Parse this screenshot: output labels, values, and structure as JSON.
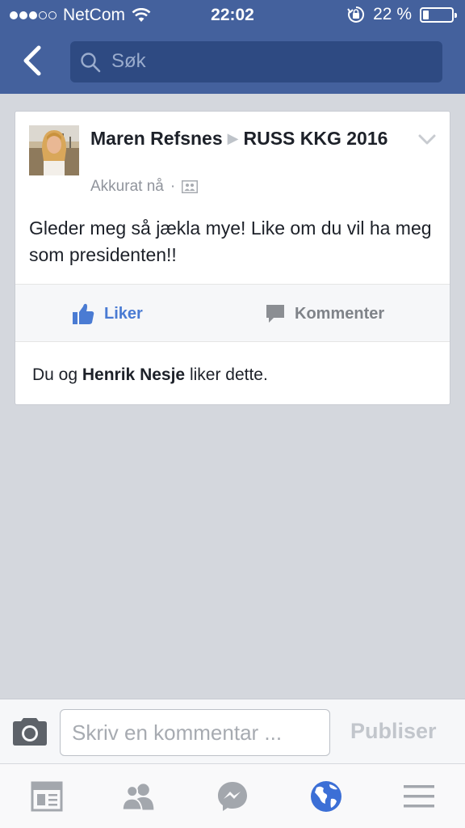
{
  "status_bar": {
    "carrier": "NetCom",
    "time": "22:02",
    "battery": "22 %",
    "battery_level": 0.22
  },
  "header": {
    "search_placeholder": "Søk"
  },
  "post": {
    "author": "Maren Refsnes",
    "group": "RUSS KKG 2016",
    "timestamp": "Akkurat nå",
    "meta_separator": "·",
    "text": "Gleder meg så jækla mye! Like om du vil ha meg som presidenten!!",
    "actions": {
      "like_label": "Liker",
      "comment_label": "Kommenter"
    },
    "likes": {
      "prefix": "Du og ",
      "name": "Henrik Nesje",
      "suffix": " liker dette."
    }
  },
  "composer": {
    "placeholder": "Skriv en kommentar ...",
    "publish_label": "Publiser"
  },
  "colors": {
    "brand": "#44619d",
    "like_blue": "#4a7bd3",
    "globe_blue": "#3c6fd6"
  },
  "tabs": [
    {
      "icon": "news-feed-icon"
    },
    {
      "icon": "friends-icon"
    },
    {
      "icon": "messenger-icon"
    },
    {
      "icon": "globe-icon"
    },
    {
      "icon": "menu-icon"
    }
  ]
}
